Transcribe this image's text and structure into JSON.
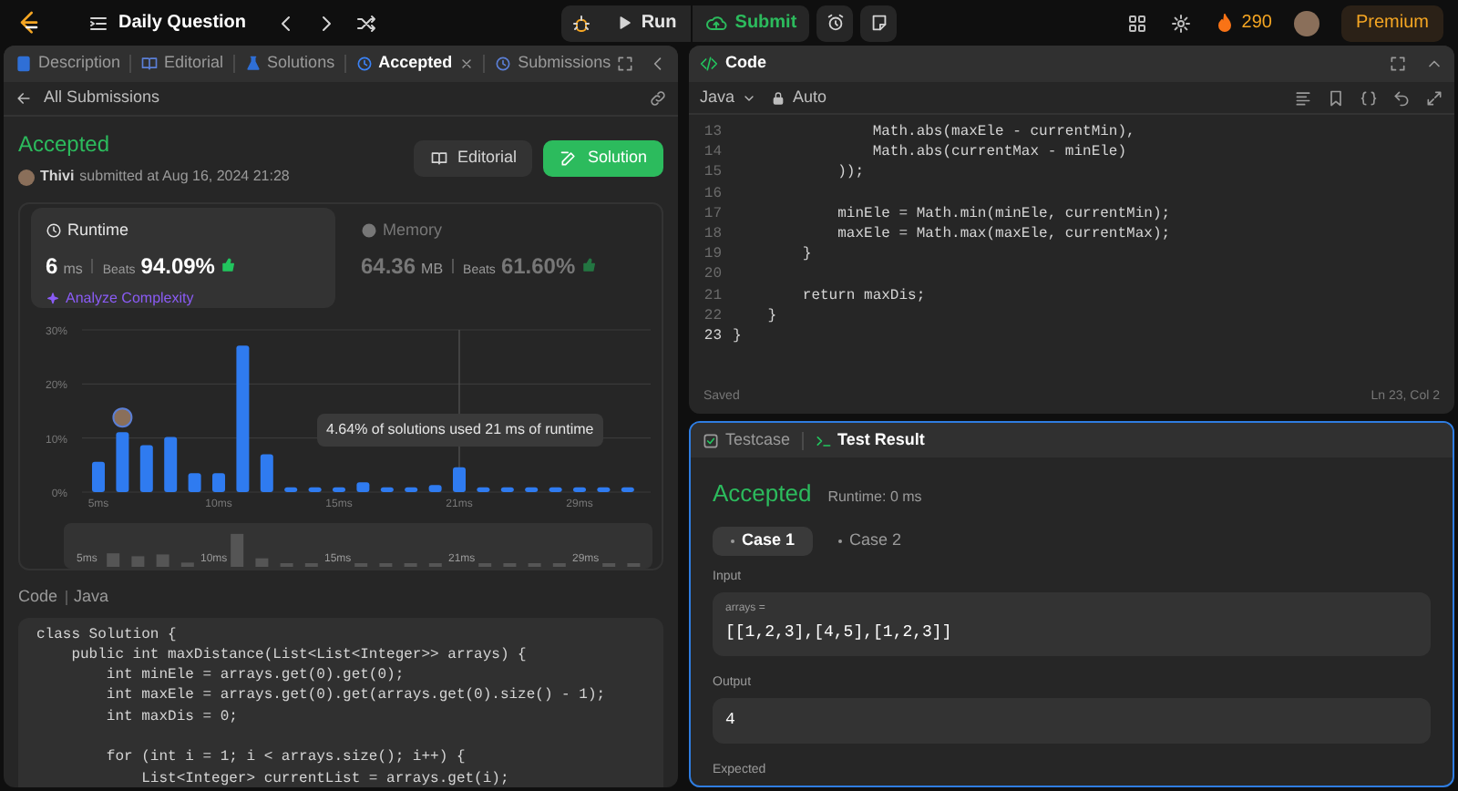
{
  "topbar": {
    "title": "Daily Question",
    "run": "Run",
    "submit": "Submit",
    "streak": "290",
    "premium": "Premium"
  },
  "left_tabs": [
    {
      "label": "Description",
      "selected": false,
      "closable": false
    },
    {
      "label": "Editorial",
      "selected": false,
      "closable": false
    },
    {
      "label": "Solutions",
      "selected": false,
      "closable": false
    },
    {
      "label": "Accepted",
      "selected": true,
      "closable": true
    },
    {
      "label": "Submissions",
      "selected": false,
      "closable": false
    }
  ],
  "submission": {
    "back": "All Submissions",
    "status": "Accepted",
    "user": "Thivi",
    "submitted": "submitted at Aug 16, 2024 21:28",
    "buttons": [
      {
        "label": "Editorial",
        "kind": "secondary"
      },
      {
        "label": "Solution",
        "kind": "primary"
      }
    ]
  },
  "stats": [
    {
      "kind": "runtime",
      "title": "Runtime",
      "value": "6",
      "unit": "ms",
      "beats_label": "Beats",
      "beats": "94.09%",
      "selected": true,
      "link": "Analyze Complexity"
    },
    {
      "kind": "memory",
      "title": "Memory",
      "value": "64.36",
      "unit": "MB",
      "beats_label": "Beats",
      "beats": "61.60%",
      "selected": false
    }
  ],
  "chart_data": {
    "type": "bar",
    "categories": [
      "5ms",
      null,
      null,
      null,
      null,
      "10ms",
      null,
      null,
      null,
      null,
      "15ms",
      null,
      null,
      null,
      null,
      "21ms",
      null,
      null,
      null,
      null,
      "29ms",
      null,
      null
    ],
    "values": [
      5.6,
      11.1,
      8.7,
      10.2,
      3.5,
      3.5,
      27.1,
      7,
      0.9,
      0.9,
      0.9,
      1.8,
      0.9,
      0.9,
      1.3,
      4.6,
      0.9,
      0.9,
      0.9,
      0.9,
      0.9,
      0.9,
      0.9
    ],
    "ylim": [
      0,
      30
    ],
    "yticks": [
      {
        "value": 0,
        "label": "0%"
      },
      {
        "value": 10,
        "label": "10%"
      },
      {
        "value": 20,
        "label": "20%"
      },
      {
        "value": 30,
        "label": "30%"
      }
    ],
    "annotations": [
      "4.64% of solutions used 21 ms of runtime"
    ]
  },
  "navigator": {
    "labels": [
      "5ms",
      "10ms",
      "15ms",
      "21ms",
      "29ms"
    ]
  },
  "code_section": {
    "label": "Code",
    "language": "Java",
    "blocks": [
      [
        "class Solution {",
        "    public int maxDistance(List<List<Integer>> arrays) {",
        "        int minEle = arrays.get(0).get(0);",
        "        int maxEle = arrays.get(0).get(arrays.get(0).size() - 1);",
        "        int maxDis = 0;"
      ],
      [
        "        for (int i = 1; i < arrays.size(); i++) {",
        "            List<Integer> currentList = arrays.get(i);"
      ]
    ]
  },
  "editor": {
    "title": "Code",
    "language": "Java",
    "mode": "Auto",
    "status": "Saved",
    "position": "Ln 23, Col 2",
    "lines": [
      {
        "number": "13",
        "text": "                Math.abs(maxEle - currentMin),"
      },
      {
        "number": "14",
        "text": "                Math.abs(currentMax - minEle)"
      },
      {
        "number": "15",
        "text": "            ));"
      },
      {
        "number": "16"
      },
      {
        "number": "17",
        "text": "            minEle = Math.min(minEle, currentMin);"
      },
      {
        "number": "18",
        "text": "            maxEle = Math.max(maxEle, currentMax);"
      },
      {
        "number": "19",
        "text": "        }"
      },
      {
        "number": "20"
      },
      {
        "number": "21",
        "text": "        return maxDis;"
      },
      {
        "number": "22",
        "text": "    }"
      },
      {
        "number": "23",
        "text": "}"
      }
    ]
  },
  "bottom_tabs": [
    {
      "label": "Testcase",
      "selected": false
    },
    {
      "label": "Test Result",
      "selected": true
    }
  ],
  "result": {
    "status": "Accepted",
    "runtime": "Runtime: 0 ms",
    "cases": [
      {
        "label": "Case 1",
        "selected": true
      },
      {
        "label": "Case 2",
        "selected": false
      }
    ],
    "input_label": "Input",
    "param": "arrays =",
    "input": "[[1,2,3],[4,5],[1,2,3]]",
    "output_label": "Output",
    "output": "4",
    "expected_label": "Expected"
  }
}
